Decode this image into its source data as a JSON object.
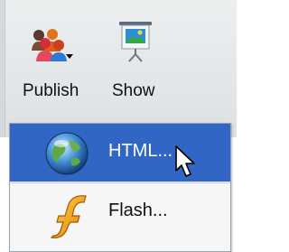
{
  "toolbar": {
    "publish": {
      "label": "Publish",
      "icon": "publish-people-icon"
    },
    "show": {
      "label": "Show",
      "icon": "slideshow-screen-icon"
    }
  },
  "publish_menu": {
    "items": [
      {
        "label": "HTML...",
        "icon": "globe-icon",
        "highlighted": true
      },
      {
        "label": "Flash...",
        "icon": "flash-icon",
        "highlighted": false
      }
    ]
  },
  "colors": {
    "toolbar_bg": "#e2e5e7",
    "menu_highlight": "#3166c4",
    "menu_bg": "#f6f6f6"
  }
}
